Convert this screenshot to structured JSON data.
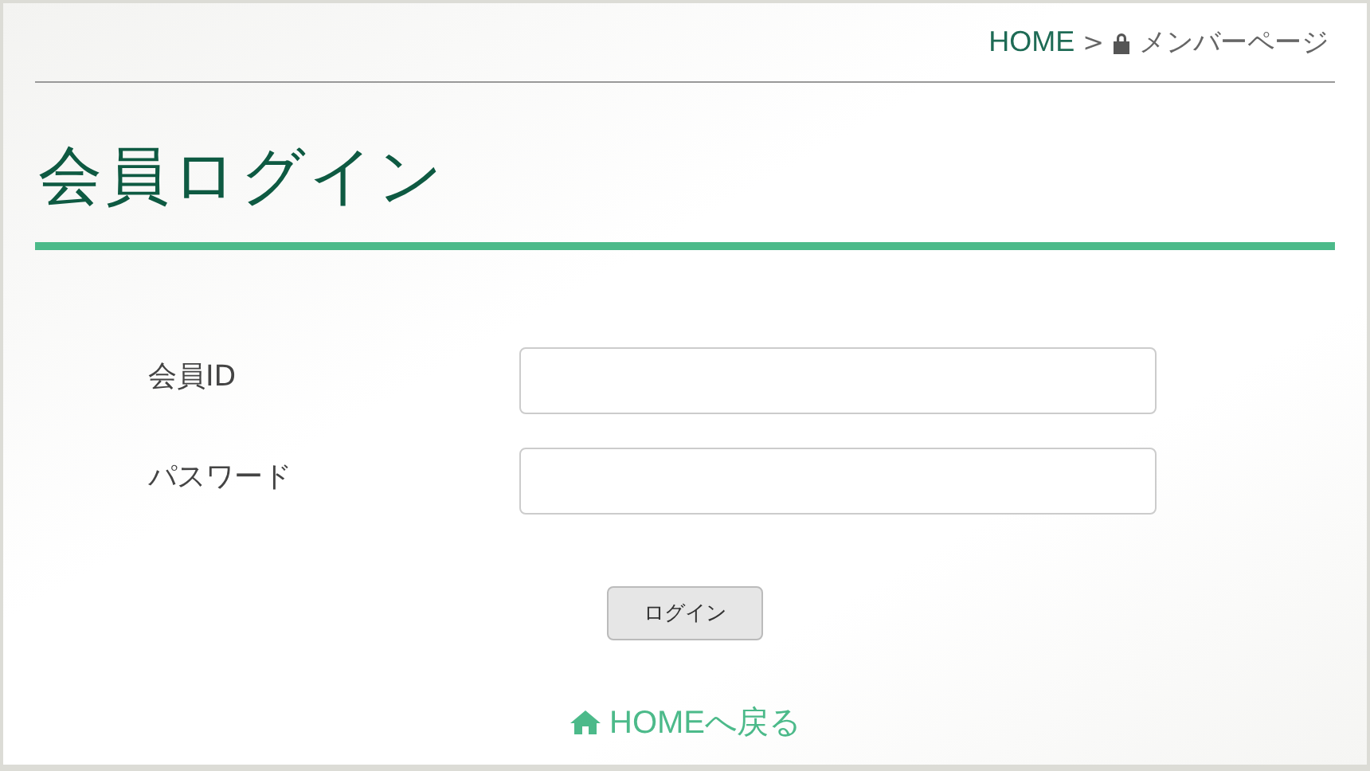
{
  "breadcrumb": {
    "home": "HOME",
    "separator": ">",
    "current": "メンバーページ"
  },
  "title": "会員ログイン",
  "fields": [
    {
      "label": "会員ID"
    },
    {
      "label": "パスワード"
    }
  ],
  "submit": "ログイン",
  "back_link": "HOMEへ戻る"
}
